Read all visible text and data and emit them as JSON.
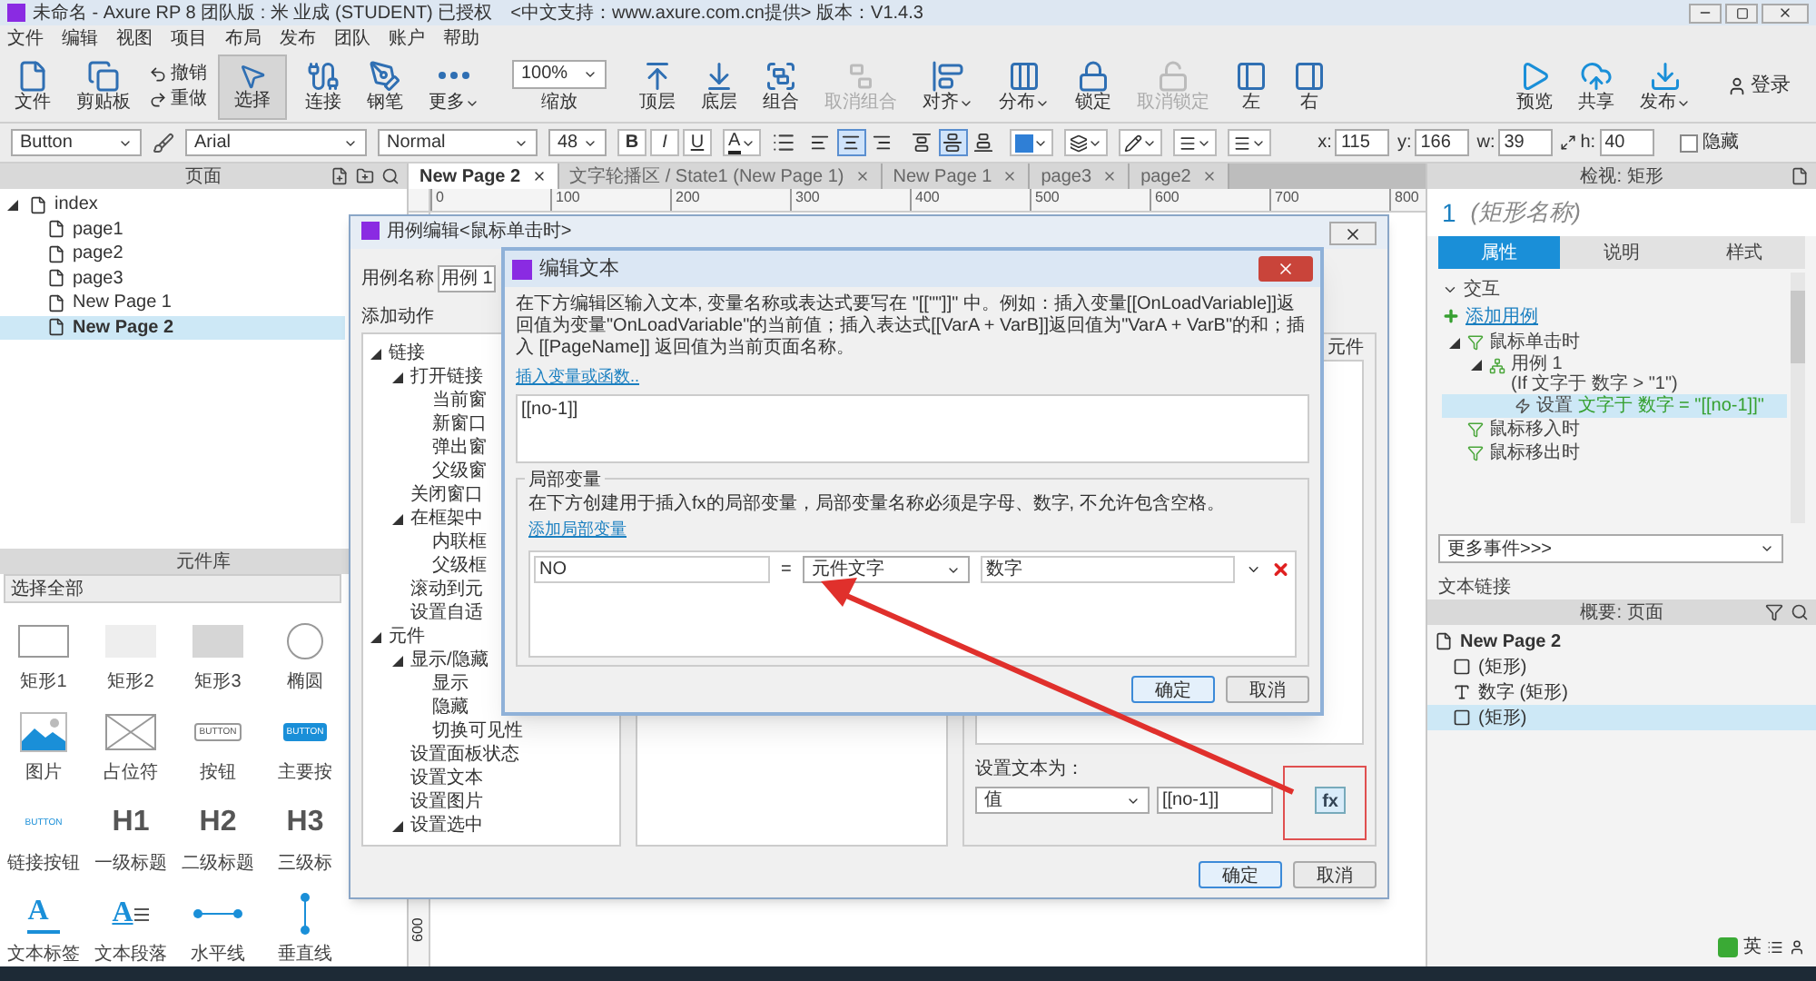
{
  "window": {
    "title": "未命名 - Axure RP 8 团队版 : 米 业成 (STUDENT) 已授权　<中文支持：www.axure.com.cn提供> 版本：V1.4.3"
  },
  "menu": [
    "文件",
    "编辑",
    "视图",
    "项目",
    "布局",
    "发布",
    "团队",
    "账户",
    "帮助"
  ],
  "toolbar": [
    {
      "kind": "big",
      "label": "文件",
      "disabled": false,
      "menu": false
    },
    {
      "kind": "big",
      "label": "剪贴板",
      "disabled": false,
      "menu": false
    },
    {
      "kind": "stack",
      "items": [
        "撤销",
        "重做"
      ]
    },
    {
      "kind": "select",
      "label": "选择"
    },
    {
      "kind": "big",
      "label": "连接",
      "disabled": false,
      "menu": false
    },
    {
      "kind": "big",
      "label": "钢笔",
      "disabled": false,
      "menu": false
    },
    {
      "kind": "big",
      "label": "更多",
      "disabled": false,
      "menu": true
    },
    {
      "kind": "zoom",
      "value": "100%",
      "label": "缩放"
    },
    {
      "kind": "big",
      "label": "顶层",
      "disabled": false,
      "menu": false
    },
    {
      "kind": "big",
      "label": "底层",
      "disabled": false,
      "menu": false
    },
    {
      "kind": "big",
      "label": "组合",
      "disabled": false,
      "menu": false
    },
    {
      "kind": "big",
      "label": "取消组合",
      "disabled": true,
      "menu": false
    },
    {
      "kind": "big",
      "label": "对齐",
      "disabled": false,
      "menu": true
    },
    {
      "kind": "big",
      "label": "分布",
      "disabled": false,
      "menu": true
    },
    {
      "kind": "big",
      "label": "锁定",
      "disabled": false,
      "menu": false
    },
    {
      "kind": "big",
      "label": "取消锁定",
      "disabled": true,
      "menu": false
    },
    {
      "kind": "big",
      "label": "左",
      "disabled": false,
      "menu": false
    },
    {
      "kind": "big",
      "label": "右",
      "disabled": false,
      "menu": false
    }
  ],
  "toolbar_right": [
    {
      "label": "预览",
      "menu": false
    },
    {
      "label": "共享",
      "menu": false
    },
    {
      "label": "发布",
      "menu": true
    }
  ],
  "login": "登录",
  "format_bar": {
    "widget_type": "Button",
    "font": "Arial",
    "font_style": "Normal",
    "font_size": "48",
    "bold": "B",
    "italic": "I",
    "underline": "U",
    "text_color": "A",
    "h_align": [
      {
        "selected": false
      },
      {
        "selected": true
      },
      {
        "selected": false
      }
    ],
    "v_align": [
      {
        "selected": false
      },
      {
        "selected": true
      },
      {
        "selected": false
      }
    ],
    "fields": [
      {
        "label": "x:",
        "value": "115"
      },
      {
        "label": "y:",
        "value": "166"
      },
      {
        "label": "w:",
        "value": "39"
      },
      {
        "label": "h:",
        "value": "40"
      }
    ],
    "hidden": {
      "label": "隐藏",
      "checked": false
    }
  },
  "pages": {
    "title": "页面",
    "root": {
      "label": "index",
      "expanded": true,
      "children": [
        {
          "label": "page1",
          "selected": false
        },
        {
          "label": "page2",
          "selected": false
        },
        {
          "label": "page3",
          "selected": false
        },
        {
          "label": "New Page 1",
          "selected": false
        },
        {
          "label": "New Page 2",
          "selected": true
        }
      ]
    }
  },
  "library": {
    "title": "元件库",
    "filter": "选择全部",
    "widgets": [
      {
        "kind": "rect1",
        "label": "矩形1"
      },
      {
        "kind": "rect2",
        "label": "矩形2"
      },
      {
        "kind": "rect3",
        "label": "矩形3"
      },
      {
        "kind": "ellipse",
        "label": "椭圆"
      },
      {
        "kind": "image",
        "label": "图片"
      },
      {
        "kind": "placeholder",
        "label": "占位符"
      },
      {
        "kind": "button",
        "label": "按钮",
        "glyph": "BUTTON"
      },
      {
        "kind": "primary_button",
        "label": "主要按",
        "glyph": "BUTTON"
      },
      {
        "kind": "link_button",
        "label": "链接按钮",
        "glyph": "BUTTON"
      },
      {
        "kind": "heading",
        "label": "一级标题",
        "glyph": "H1"
      },
      {
        "kind": "heading",
        "label": "二级标题",
        "glyph": "H2"
      },
      {
        "kind": "heading",
        "label": "三级标",
        "glyph": "H3"
      },
      {
        "kind": "text_label",
        "label": "文本标签",
        "glyph": "A"
      },
      {
        "kind": "paragraph",
        "label": "文本段落",
        "glyph": "A"
      },
      {
        "kind": "hline",
        "label": "水平线"
      },
      {
        "kind": "vline",
        "label": "垂直线"
      }
    ]
  },
  "tabs": [
    {
      "label": "New Page 2",
      "selected": true
    },
    {
      "label": "文字轮播区 / State1 (New Page 1)",
      "selected": false
    },
    {
      "label": "New Page 1",
      "selected": false
    },
    {
      "label": "page3",
      "selected": false
    },
    {
      "label": "page2",
      "selected": false
    }
  ],
  "canvas": {
    "ruler_marks": [
      "0",
      "100",
      "200",
      "300",
      "400",
      "500",
      "600",
      "700",
      "800"
    ],
    "vertical_ruler_mark": "600"
  },
  "case_editor": {
    "title": "用例编辑<鼠标单击时>",
    "case_name_label": "用例名称",
    "case_name": "用例 1",
    "add_action_label": "添加动作",
    "actions": [
      {
        "label": "链接",
        "expanded": true,
        "children": [
          {
            "label": "打开链接",
            "expanded": true,
            "children": [
              {
                "label": "当前窗"
              },
              {
                "label": "新窗口"
              },
              {
                "label": "弹出窗"
              },
              {
                "label": "父级窗"
              }
            ]
          },
          {
            "label": "关闭窗口"
          },
          {
            "label": "在框架中",
            "expanded": true,
            "children": [
              {
                "label": "内联框"
              },
              {
                "label": "父级框"
              }
            ]
          },
          {
            "label": "滚动到元"
          },
          {
            "label": "设置自适"
          }
        ]
      },
      {
        "label": "元件",
        "expanded": true,
        "children": [
          {
            "label": "显示/隐藏",
            "expanded": true,
            "children": [
              {
                "label": "显示"
              },
              {
                "label": "隐藏"
              },
              {
                "label": "切换可见性"
              }
            ]
          },
          {
            "label": "设置面板状态"
          },
          {
            "label": "设置文本"
          },
          {
            "label": "设置图片"
          },
          {
            "label": "设置选中",
            "expanded": true
          }
        ]
      }
    ],
    "widgets_label": "元件",
    "set_text_label": "设置文本为：",
    "value_type": "值",
    "value": "[[no-1]]",
    "fx": "fx",
    "buttons": [
      "确定",
      "取消"
    ]
  },
  "text_editor": {
    "title": "编辑文本",
    "description": "在下方编辑区输入文本, 变量名称或表达式要写在 \"[[\"\"]]\" 中。例如：插入变量[[OnLoadVariable]]返回值为变量\"OnLoadVariable\"的当前值；插入表达式[[VarA + VarB]]返回值为\"VarA + VarB\"的和；插入 [[PageName]] 返回值为当前页面名称。",
    "insert_link": "插入变量或函数..",
    "text": "[[no-1]]",
    "locals": {
      "legend": "局部变量",
      "description": "在下方创建用于插入fx的局部变量，局部变量名称必须是字母、数字, 不允许包含空格。",
      "add_link": "添加局部变量",
      "rows": [
        {
          "name": "NO",
          "equals": "=",
          "type": "元件文字",
          "widget": "数字"
        }
      ]
    },
    "buttons": [
      "确定",
      "取消"
    ]
  },
  "inspector": {
    "title": "检视: 矩形",
    "widget_number": "1",
    "name_placeholder": "(矩形名称)",
    "tabs": [
      {
        "label": "属性",
        "selected": true
      },
      {
        "label": "说明",
        "selected": false
      },
      {
        "label": "样式",
        "selected": false
      }
    ],
    "section": {
      "label": "交互",
      "expanded": true
    },
    "add_case": "添加用例",
    "events": [
      {
        "label": "鼠标单击时",
        "expanded": true,
        "cases": [
          {
            "label": "用例 1",
            "condition": "(If 文字于 数字 > \"1\")",
            "expanded": true,
            "actions": [
              {
                "verb": "设置",
                "detail": "文字于 数字 = \"[[no-1]]\"",
                "selected": true
              }
            ]
          }
        ]
      },
      {
        "label": "鼠标移入时",
        "expanded": false
      },
      {
        "label": "鼠标移出时",
        "expanded": false
      }
    ],
    "more_events": "更多事件>>>",
    "text_link": "文本链接"
  },
  "outline": {
    "title": "概要: 页面",
    "root": "New Page 2",
    "items": [
      {
        "kind": "rect",
        "label": "(矩形)",
        "selected": false
      },
      {
        "kind": "text",
        "label": "数字 (矩形)",
        "selected": false
      },
      {
        "kind": "rect",
        "label": "(矩形)",
        "selected": true
      }
    ]
  },
  "ime": {
    "label": "英"
  }
}
